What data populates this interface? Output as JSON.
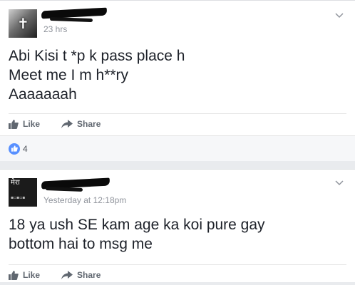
{
  "posts": [
    {
      "timestamp": "23 hrs",
      "text_lines": [
        "Abi Kisi t *p k pass place h",
        "Meet me I m h**ry",
        "Aaaaaaah"
      ],
      "actions": {
        "like": "Like",
        "share": "Share"
      },
      "reaction_count": "4"
    },
    {
      "timestamp": "Yesterday at 12:18pm",
      "text_lines": [
        "18 ya ush SE kam age ka koi pure gay",
        "bottom hai to msg me"
      ],
      "actions": {
        "like": "Like",
        "share": "Share"
      },
      "avatar_text": "मेरा"
    }
  ],
  "colors": {
    "page_bg": "#e9ebee",
    "card_bg": "#ffffff",
    "text": "#1d2129",
    "meta": "#90949c",
    "action": "#606770",
    "like_blue": "#5890ff"
  },
  "icons": [
    "chevron-down-icon",
    "thumbs-up-icon",
    "share-arrow-icon",
    "like-reaction-icon"
  ]
}
